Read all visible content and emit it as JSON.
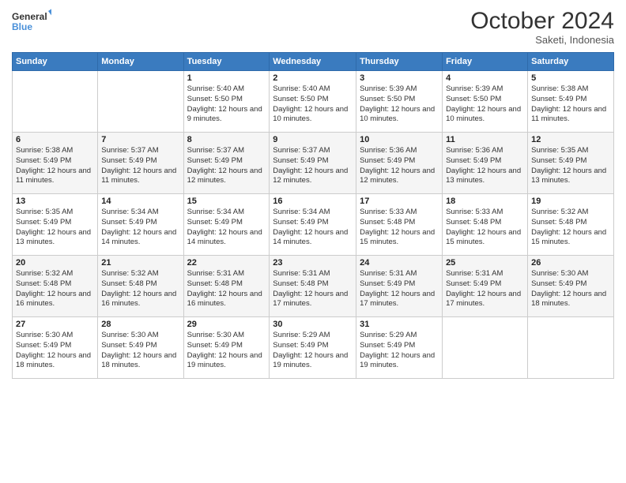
{
  "logo": {
    "line1": "General",
    "line2": "Blue"
  },
  "header": {
    "month": "October 2024",
    "location": "Saketi, Indonesia"
  },
  "weekdays": [
    "Sunday",
    "Monday",
    "Tuesday",
    "Wednesday",
    "Thursday",
    "Friday",
    "Saturday"
  ],
  "weeks": [
    [
      {
        "day": "",
        "info": ""
      },
      {
        "day": "",
        "info": ""
      },
      {
        "day": "1",
        "info": "Sunrise: 5:40 AM\nSunset: 5:50 PM\nDaylight: 12 hours and 9 minutes."
      },
      {
        "day": "2",
        "info": "Sunrise: 5:40 AM\nSunset: 5:50 PM\nDaylight: 12 hours and 10 minutes."
      },
      {
        "day": "3",
        "info": "Sunrise: 5:39 AM\nSunset: 5:50 PM\nDaylight: 12 hours and 10 minutes."
      },
      {
        "day": "4",
        "info": "Sunrise: 5:39 AM\nSunset: 5:50 PM\nDaylight: 12 hours and 10 minutes."
      },
      {
        "day": "5",
        "info": "Sunrise: 5:38 AM\nSunset: 5:49 PM\nDaylight: 12 hours and 11 minutes."
      }
    ],
    [
      {
        "day": "6",
        "info": "Sunrise: 5:38 AM\nSunset: 5:49 PM\nDaylight: 12 hours and 11 minutes."
      },
      {
        "day": "7",
        "info": "Sunrise: 5:37 AM\nSunset: 5:49 PM\nDaylight: 12 hours and 11 minutes."
      },
      {
        "day": "8",
        "info": "Sunrise: 5:37 AM\nSunset: 5:49 PM\nDaylight: 12 hours and 12 minutes."
      },
      {
        "day": "9",
        "info": "Sunrise: 5:37 AM\nSunset: 5:49 PM\nDaylight: 12 hours and 12 minutes."
      },
      {
        "day": "10",
        "info": "Sunrise: 5:36 AM\nSunset: 5:49 PM\nDaylight: 12 hours and 12 minutes."
      },
      {
        "day": "11",
        "info": "Sunrise: 5:36 AM\nSunset: 5:49 PM\nDaylight: 12 hours and 13 minutes."
      },
      {
        "day": "12",
        "info": "Sunrise: 5:35 AM\nSunset: 5:49 PM\nDaylight: 12 hours and 13 minutes."
      }
    ],
    [
      {
        "day": "13",
        "info": "Sunrise: 5:35 AM\nSunset: 5:49 PM\nDaylight: 12 hours and 13 minutes."
      },
      {
        "day": "14",
        "info": "Sunrise: 5:34 AM\nSunset: 5:49 PM\nDaylight: 12 hours and 14 minutes."
      },
      {
        "day": "15",
        "info": "Sunrise: 5:34 AM\nSunset: 5:49 PM\nDaylight: 12 hours and 14 minutes."
      },
      {
        "day": "16",
        "info": "Sunrise: 5:34 AM\nSunset: 5:49 PM\nDaylight: 12 hours and 14 minutes."
      },
      {
        "day": "17",
        "info": "Sunrise: 5:33 AM\nSunset: 5:48 PM\nDaylight: 12 hours and 15 minutes."
      },
      {
        "day": "18",
        "info": "Sunrise: 5:33 AM\nSunset: 5:48 PM\nDaylight: 12 hours and 15 minutes."
      },
      {
        "day": "19",
        "info": "Sunrise: 5:32 AM\nSunset: 5:48 PM\nDaylight: 12 hours and 15 minutes."
      }
    ],
    [
      {
        "day": "20",
        "info": "Sunrise: 5:32 AM\nSunset: 5:48 PM\nDaylight: 12 hours and 16 minutes."
      },
      {
        "day": "21",
        "info": "Sunrise: 5:32 AM\nSunset: 5:48 PM\nDaylight: 12 hours and 16 minutes."
      },
      {
        "day": "22",
        "info": "Sunrise: 5:31 AM\nSunset: 5:48 PM\nDaylight: 12 hours and 16 minutes."
      },
      {
        "day": "23",
        "info": "Sunrise: 5:31 AM\nSunset: 5:48 PM\nDaylight: 12 hours and 17 minutes."
      },
      {
        "day": "24",
        "info": "Sunrise: 5:31 AM\nSunset: 5:49 PM\nDaylight: 12 hours and 17 minutes."
      },
      {
        "day": "25",
        "info": "Sunrise: 5:31 AM\nSunset: 5:49 PM\nDaylight: 12 hours and 17 minutes."
      },
      {
        "day": "26",
        "info": "Sunrise: 5:30 AM\nSunset: 5:49 PM\nDaylight: 12 hours and 18 minutes."
      }
    ],
    [
      {
        "day": "27",
        "info": "Sunrise: 5:30 AM\nSunset: 5:49 PM\nDaylight: 12 hours and 18 minutes."
      },
      {
        "day": "28",
        "info": "Sunrise: 5:30 AM\nSunset: 5:49 PM\nDaylight: 12 hours and 18 minutes."
      },
      {
        "day": "29",
        "info": "Sunrise: 5:30 AM\nSunset: 5:49 PM\nDaylight: 12 hours and 19 minutes."
      },
      {
        "day": "30",
        "info": "Sunrise: 5:29 AM\nSunset: 5:49 PM\nDaylight: 12 hours and 19 minutes."
      },
      {
        "day": "31",
        "info": "Sunrise: 5:29 AM\nSunset: 5:49 PM\nDaylight: 12 hours and 19 minutes."
      },
      {
        "day": "",
        "info": ""
      },
      {
        "day": "",
        "info": ""
      }
    ]
  ]
}
